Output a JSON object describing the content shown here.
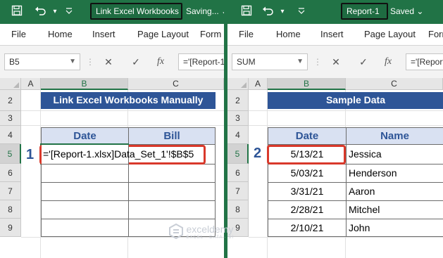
{
  "colors": {
    "excel_green": "#217346",
    "header_blue": "#2e5597",
    "table_header_fill": "#d9e1f2",
    "highlight_red": "#d9392b"
  },
  "icons": {
    "save": "save-icon",
    "undo": "undo-icon",
    "customize": "chevron-down-icon",
    "cancel": "close-icon",
    "enter": "check-icon",
    "function": "fx-icon"
  },
  "left_window": {
    "title": "Link Excel Workbooks",
    "status": "Saving...",
    "status_caret": "⌄",
    "ribbon_tabs": [
      "File",
      "Home",
      "Insert",
      "Page Layout",
      "Form"
    ],
    "name_box": "B5",
    "formula": "='[Report-1.xlsx]Data_Set_1'!$B$5",
    "columns": [
      "A",
      "B",
      "C"
    ],
    "rows": [
      "2",
      "3",
      "4",
      "5",
      "6",
      "7",
      "8",
      "9"
    ],
    "banner": "Link Excel Workbooks Manually",
    "table_headers": [
      "Date",
      "Bill"
    ],
    "formula_cell": "='[Report-1.xlsx]Data_Set_1'!$B$5",
    "step_number": "1"
  },
  "right_window": {
    "title": "Report-1",
    "status": "Saved",
    "status_caret": "⌄",
    "ribbon_tabs": [
      "File",
      "Home",
      "Insert",
      "Page Layout",
      "Form"
    ],
    "name_box": "SUM",
    "formula": "='[Report-1",
    "columns": [
      "A",
      "B",
      "C"
    ],
    "rows": [
      "2",
      "3",
      "4",
      "5",
      "6",
      "7",
      "8",
      "9"
    ],
    "banner": "Sample Data",
    "table_headers": [
      "Date",
      "Name"
    ],
    "table_rows": [
      {
        "date": "5/13/21",
        "name": "Jessica"
      },
      {
        "date": "5/03/21",
        "name": "Henderson"
      },
      {
        "date": "3/31/21",
        "name": "Aaron"
      },
      {
        "date": "2/28/21",
        "name": "Mitchel"
      },
      {
        "date": "2/10/21",
        "name": "John"
      }
    ],
    "step_number": "2"
  },
  "watermark": {
    "brand": "exceldemy",
    "tagline": "EXCEL · DATA · BI"
  }
}
